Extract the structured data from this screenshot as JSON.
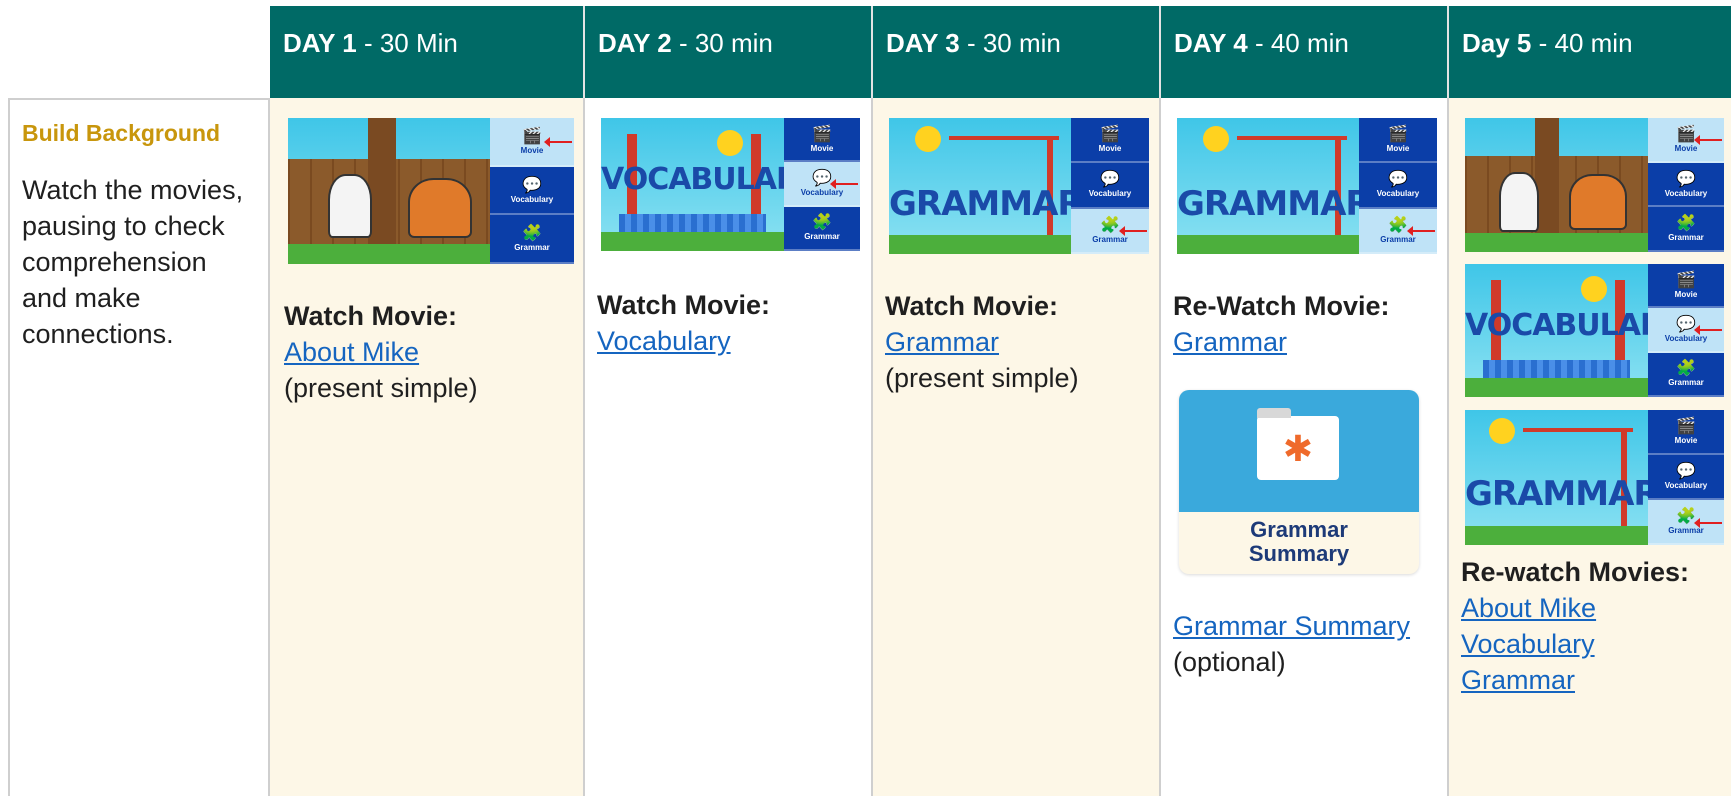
{
  "headers": [
    {
      "day": "DAY 1",
      "duration": " - 30 Min"
    },
    {
      "day": "DAY 2",
      "duration": " - 30 min"
    },
    {
      "day": "DAY 3",
      "duration": " - 30 min"
    },
    {
      "day": "DAY 4",
      "duration": " - 40 min"
    },
    {
      "day": "Day 5",
      "duration": " - 40 min"
    }
  ],
  "left": {
    "heading": "Build Background",
    "description": "Watch the movies, pausing to check comprehension and make connections."
  },
  "nav_labels": {
    "movie": "Movie",
    "vocabulary": "Vocabulary",
    "grammar": "Grammar"
  },
  "thumb_titles": {
    "vocabulary": "VOCABULARY",
    "grammar": "GRAMMAR"
  },
  "day1": {
    "title": "Watch Movie:",
    "link": "About Mike",
    "note": "(present simple)"
  },
  "day2": {
    "title": "Watch Movie:",
    "link": "Vocabulary"
  },
  "day3": {
    "title": "Watch Movie:",
    "link": "Grammar",
    "note": "(present simple)"
  },
  "day4": {
    "title": "Re-Watch Movie:",
    "link": "Grammar",
    "card_label_1": "Grammar",
    "card_label_2": "Summary",
    "summary_link": "Grammar Summary",
    "summary_note": "(optional)"
  },
  "day5": {
    "title": "Re-watch Movies:",
    "links": [
      "About Mike",
      "Vocabulary",
      "Grammar"
    ]
  },
  "colors": {
    "header_bg": "#006a66",
    "cream": "#fdf7e7",
    "accent_gold": "#c8960c",
    "link": "#1565c0",
    "nav_blue": "#0b3ea8"
  }
}
